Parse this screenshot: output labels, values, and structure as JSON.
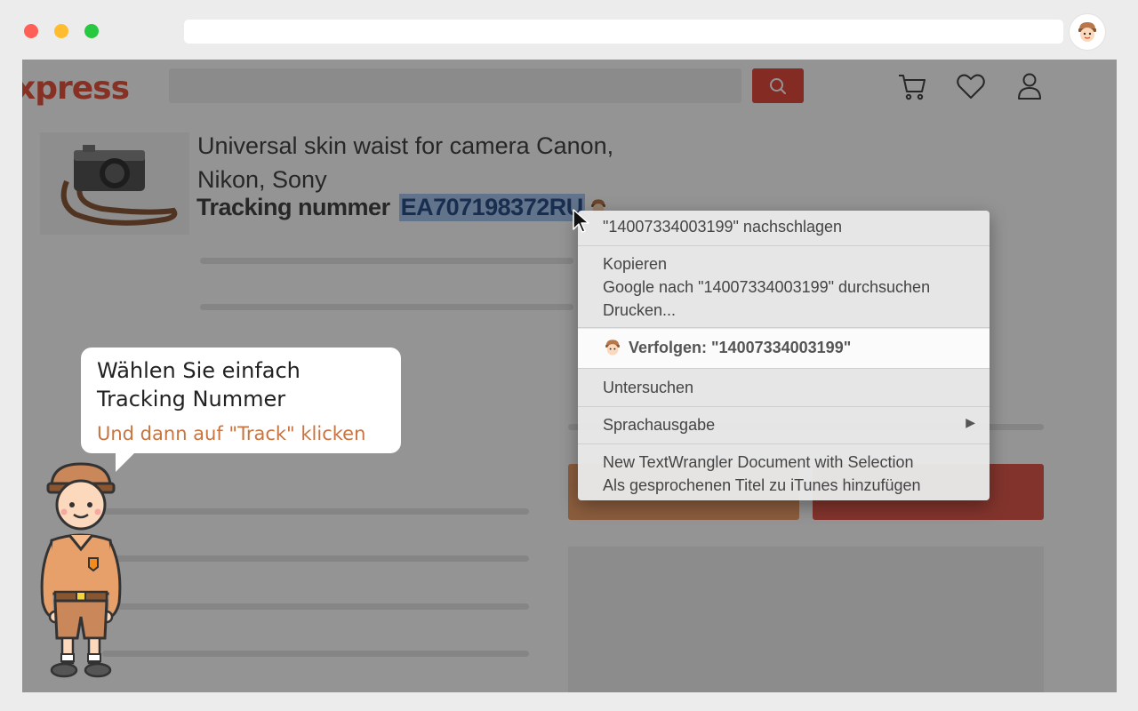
{
  "browser": {
    "url": ""
  },
  "site": {
    "logo_text": "xpress",
    "product": {
      "title": "Universal skin waist for camera Canon, Nikon, Sony",
      "tracking_label": "Tracking nummer",
      "tracking_number": "EA707198372RU"
    }
  },
  "context_menu": {
    "lookup": "\"14007334003199\" nachschlagen",
    "copy": "Kopieren",
    "google_search": "Google nach \"14007334003199\" durchsuchen",
    "print": "Drucken...",
    "track": "Verfolgen: \"14007334003199\"",
    "inspect": "Untersuchen",
    "speech": "Sprachausgabe",
    "speech_arrow": "▶",
    "textwrangler": "New TextWrangler Document with Selection",
    "itunes": "Als gesprochenen Titel zu iTunes hinzufügen"
  },
  "tooltip": {
    "title": "Wählen Sie einfach Tracking Nummer",
    "subtitle": "Und dann auf \"Track\" klicken"
  },
  "colors": {
    "accent_red": "#e34b3d",
    "accent_orange": "#c87440",
    "selection": "#a8c8ef"
  }
}
